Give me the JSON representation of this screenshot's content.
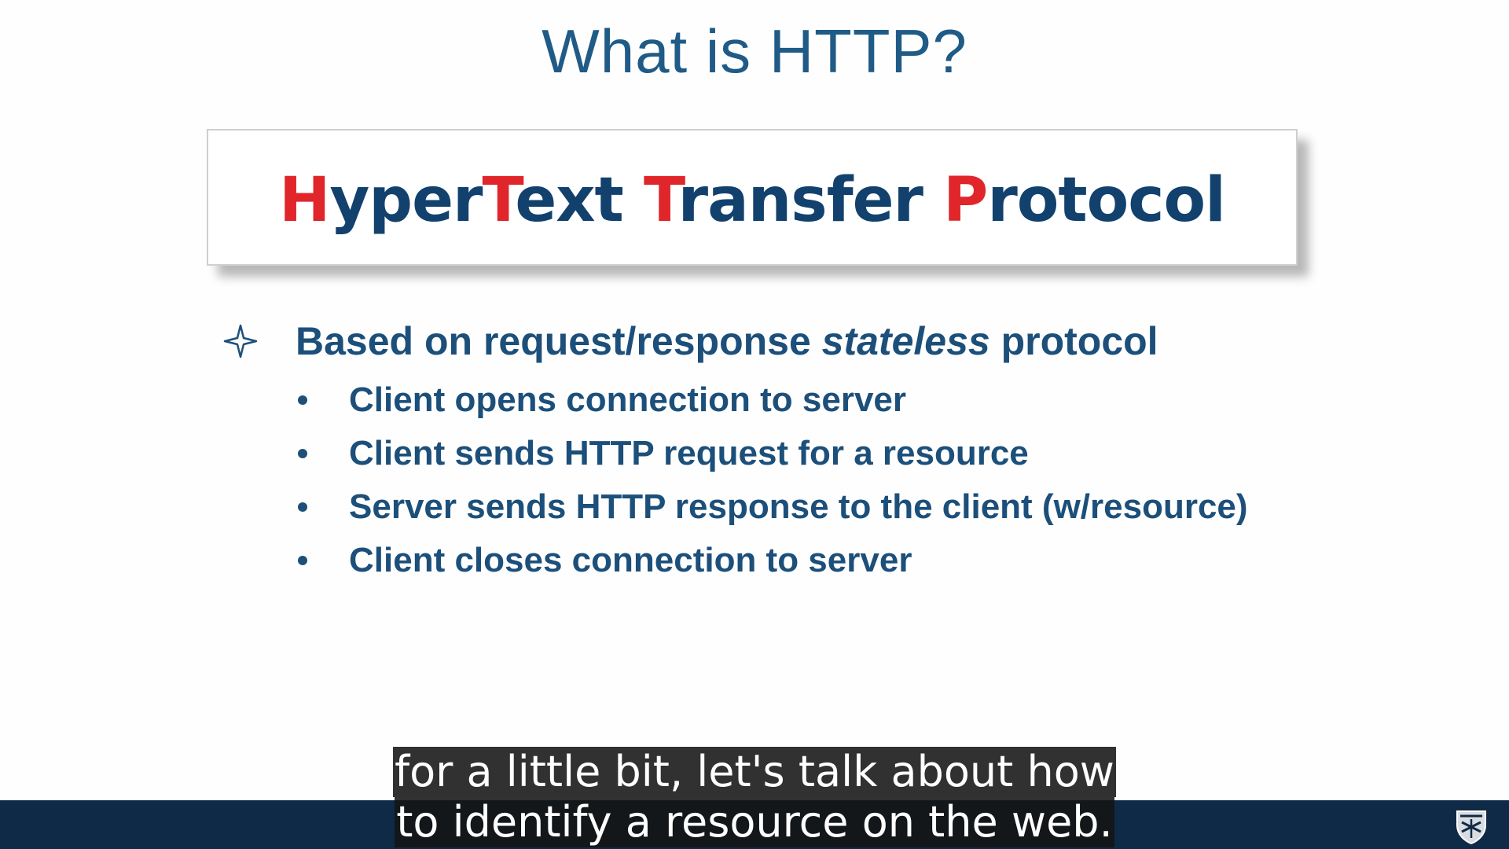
{
  "slide": {
    "title": "What is HTTP?",
    "acronym": {
      "parts": [
        {
          "text": "H",
          "highlight": true
        },
        {
          "text": "yper",
          "highlight": false
        },
        {
          "text": "T",
          "highlight": true
        },
        {
          "text": "ext ",
          "highlight": false
        },
        {
          "text": "T",
          "highlight": true
        },
        {
          "text": "ransfer ",
          "highlight": false
        },
        {
          "text": "P",
          "highlight": true
        },
        {
          "text": "rotocol",
          "highlight": false
        }
      ]
    },
    "main_bullet": {
      "icon": "four-point-star-icon",
      "before": "Based on request/response ",
      "emphasis": "stateless",
      "after": " protocol"
    },
    "sub_bullets": [
      "Client opens connection to server",
      "Client sends HTTP request for a resource",
      "Server sends HTTP response to the client (w/resource)",
      "Client closes connection to server"
    ]
  },
  "captions": {
    "line1": "for a little bit, let's talk about how",
    "line2": "to identify a resource on the web."
  },
  "footer": {
    "logo_icon": "university-shield-icon"
  },
  "colors": {
    "title": "#1f5b86",
    "acronym_text": "#12416e",
    "acronym_highlight": "#e0262a",
    "bullet_text": "#1c4f7a",
    "bottom_bar": "#0f2a46"
  }
}
